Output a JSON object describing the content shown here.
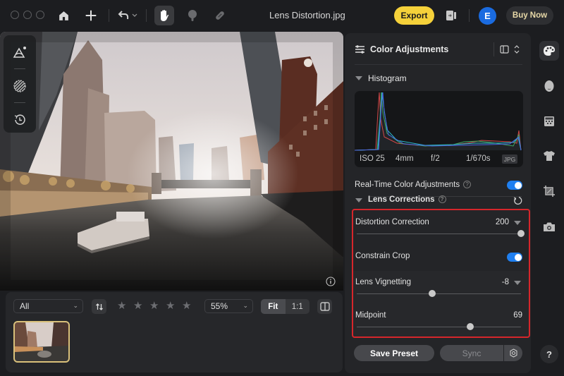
{
  "titlebar": {
    "title": "Lens Distortion.jpg",
    "export_label": "Export",
    "avatar_initial": "E",
    "buy_label": "Buy Now"
  },
  "canvas": {
    "image_description": "Fisheye photo of city river with skyscrapers and tour boat"
  },
  "filmstrip": {
    "filter_value": "All",
    "rating_stars": 5,
    "zoom_value": "55%",
    "fit_label": "Fit",
    "one_to_one_label": "1:1"
  },
  "panel": {
    "title": "Color Adjustments",
    "histogram_label": "Histogram",
    "exif": {
      "iso": "ISO 25",
      "focal": "4mm",
      "aperture": "f/2",
      "shutter": "1/670s",
      "format": "JPG"
    },
    "realtime_label": "Real-Time Color Adjustments",
    "realtime_on": true,
    "lens_corrections_label": "Lens Corrections",
    "distortion": {
      "label": "Distortion Correction",
      "value": "200",
      "fraction": 1.0
    },
    "constrain_crop": {
      "label": "Constrain Crop",
      "on": true
    },
    "vignetting": {
      "label": "Lens Vignetting",
      "value": "-8",
      "fraction": 0.46
    },
    "midpoint": {
      "label": "Midpoint",
      "value": "69",
      "fraction": 0.69
    },
    "save_preset_label": "Save Preset",
    "sync_label": "Sync"
  },
  "sidebar": {
    "help_label": "?"
  },
  "colors": {
    "accent_export": "#f5d13a",
    "toggle_on": "#1f7ff0",
    "highlight_box": "#d6262b",
    "avatar": "#1a6be0"
  }
}
